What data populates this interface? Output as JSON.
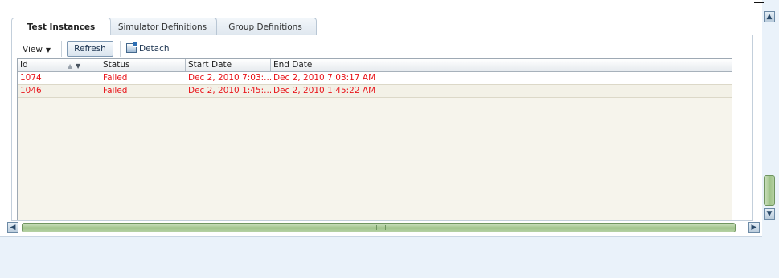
{
  "tabs": [
    {
      "label": "Test Instances",
      "active": true
    },
    {
      "label": "Simulator Definitions",
      "active": false
    },
    {
      "label": "Group Definitions",
      "active": false
    }
  ],
  "toolbar": {
    "view_label": "View",
    "refresh_label": "Refresh",
    "detach_label": "Detach"
  },
  "table": {
    "columns": [
      "Id",
      "Status",
      "Start Date",
      "End Date"
    ],
    "rows": [
      {
        "id": "1074",
        "status": "Failed",
        "start": "Dec 2, 2010 7:03:...",
        "end": "Dec 2, 2010 7:03:17 AM"
      },
      {
        "id": "1046",
        "status": "Failed",
        "start": "Dec 2, 2010 1:45:...",
        "end": "Dec 2, 2010 1:45:22 AM"
      }
    ],
    "row_text_color": "#e8151b"
  },
  "icons": {
    "sort": "sort-asc-desc-icon",
    "detach": "detach-window-icon",
    "scroll_left": "arrow-left-icon",
    "scroll_right": "arrow-right-icon",
    "scroll_up": "arrow-up-icon",
    "scroll_down": "arrow-down-icon"
  }
}
